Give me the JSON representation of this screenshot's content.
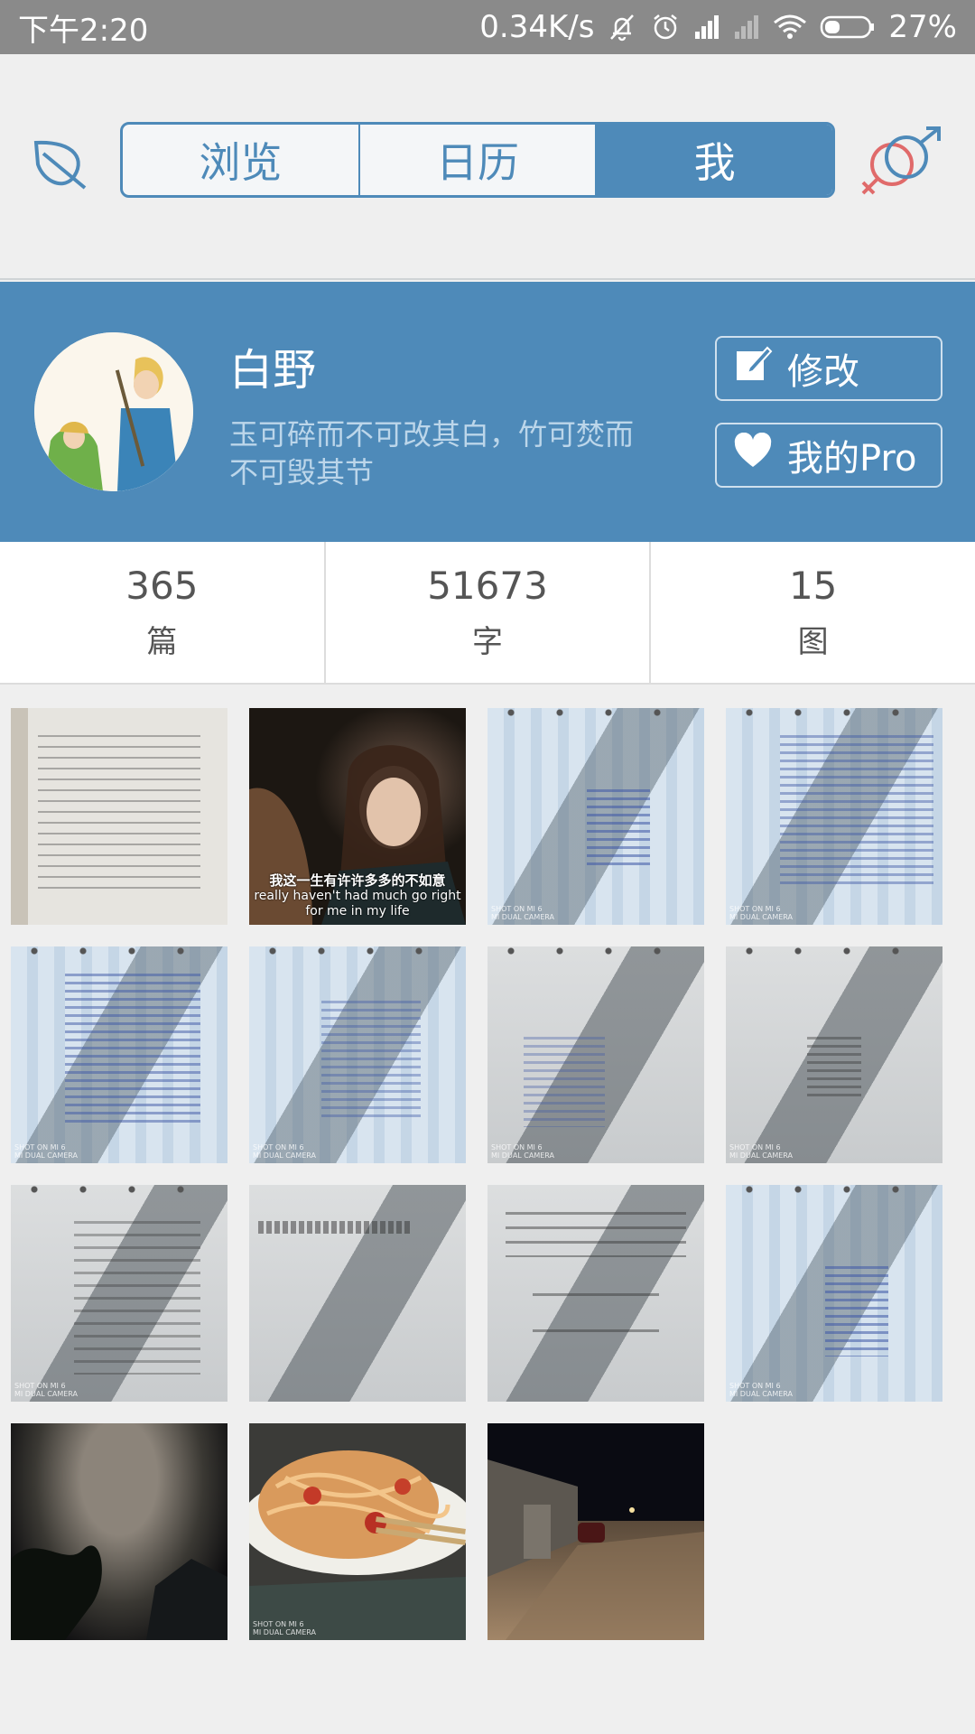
{
  "status_bar": {
    "time": "下午2:20",
    "speed": "0.34K/s",
    "battery": "27%",
    "icons": [
      "mute-bell-icon",
      "alarm-icon",
      "signal-icon",
      "signal-weak-icon",
      "wifi-icon",
      "battery-icon"
    ]
  },
  "nav": {
    "tabs": [
      {
        "label": "浏览",
        "active": false
      },
      {
        "label": "日历",
        "active": false
      },
      {
        "label": "我",
        "active": true
      }
    ],
    "left_icon": "leaf-icon",
    "right_icon": "gender-icon",
    "accent": "#4e8ab9"
  },
  "profile": {
    "name": "白野",
    "motto": "玉可碎而不可改其白，竹可焚而不可毁其节",
    "edit_label": "修改",
    "pro_label": "我的Pro",
    "edit_icon": "edit-icon",
    "pro_icon": "heart-icon"
  },
  "stats": [
    {
      "value": "365",
      "label": "篇"
    },
    {
      "value": "51673",
      "label": "字"
    },
    {
      "value": "15",
      "label": "图"
    }
  ],
  "gallery": {
    "subtitle_cn": "我这一生有许许多多的不如意",
    "subtitle_en": "really haven't had much go right for me in my life",
    "watermark": "SHOT ON MI 6\nMI DUAL CAMERA"
  }
}
